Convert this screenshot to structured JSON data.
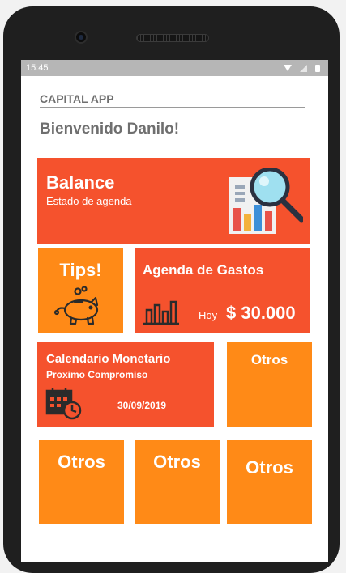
{
  "device": {
    "time": "15:45"
  },
  "app": {
    "name": "CAPITAL APP",
    "welcome": "Bienvenido Danilo!"
  },
  "tiles": {
    "balance": {
      "title": "Balance",
      "subtitle": "Estado de agenda",
      "icon": "report-magnifier-icon"
    },
    "tips": {
      "title": "Tips!",
      "icon": "piggy-bank-icon"
    },
    "gastos": {
      "title": "Agenda de Gastos",
      "hoy_label": "Hoy",
      "amount": "$ 30.000",
      "icon": "bar-chart-icon"
    },
    "calendario": {
      "title": "Calendario Monetario",
      "subtitle": "Proximo Compromiso",
      "date": "30/09/2019",
      "icon": "calendar-clock-icon"
    },
    "otros1": {
      "label": "Otros"
    },
    "otros2": {
      "label": "Otros"
    },
    "otros3": {
      "label": "Otros"
    },
    "otros4": {
      "label": "Otros"
    }
  },
  "colors": {
    "red_tile": "#f5522d",
    "orange_tile": "#ff8a17",
    "text_gray": "#6f6f6f"
  }
}
